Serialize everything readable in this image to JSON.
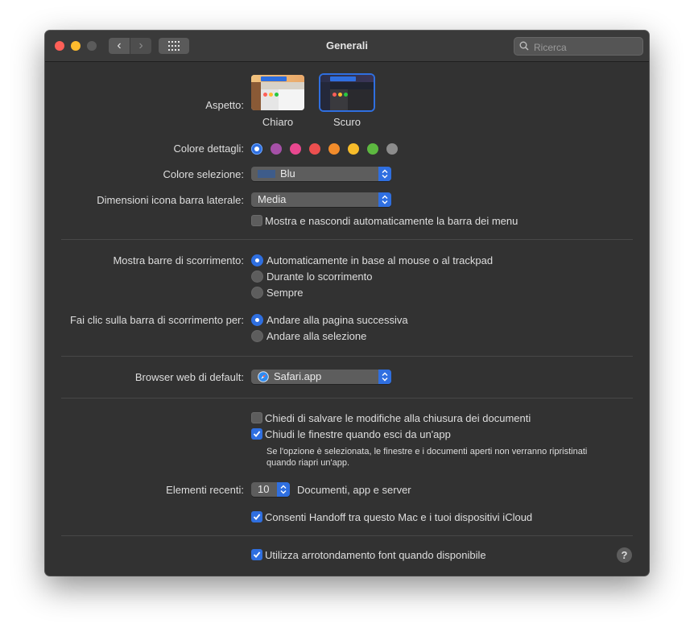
{
  "window": {
    "title": "Generali"
  },
  "search": {
    "placeholder": "Ricerca"
  },
  "appearance": {
    "label": "Aspetto:",
    "options": [
      "Chiaro",
      "Scuro"
    ],
    "selected": "Scuro"
  },
  "accent": {
    "label": "Colore dettagli:",
    "colors": [
      "#2f6fe0",
      "#a550a7",
      "#e8488f",
      "#ec4f4f",
      "#f28c2b",
      "#f7bc2a",
      "#5db840",
      "#8c8c8c"
    ],
    "selected_index": 0
  },
  "highlight": {
    "label": "Colore selezione:",
    "value": "Blu",
    "swatch_color": "#3e5c8a"
  },
  "sidebar_icon": {
    "label": "Dimensioni icona barra laterale:",
    "value": "Media"
  },
  "auto_hide_menu": {
    "label": "Mostra e nascondi automaticamente la barra dei menu",
    "checked": false
  },
  "scroll_bars": {
    "label": "Mostra barre di scorrimento:",
    "options": [
      "Automaticamente in base al mouse o al trackpad",
      "Durante lo scorrimento",
      "Sempre"
    ],
    "selected_index": 0
  },
  "click_scroll": {
    "label": "Fai clic sulla barra di scorrimento per:",
    "options": [
      "Andare alla pagina successiva",
      "Andare alla selezione"
    ],
    "selected_index": 0
  },
  "browser": {
    "label": "Browser web di default:",
    "value": "Safari.app"
  },
  "ask_save": {
    "label": "Chiedi di salvare le modifiche alla chiusura dei documenti",
    "checked": false
  },
  "close_windows": {
    "label": "Chiudi le finestre quando esci da un'app",
    "checked": true,
    "note_line1": "Se l'opzione è selezionata, le finestre e i documenti aperti non verranno ripristinati",
    "note_line2": "quando riapri un'app."
  },
  "recent": {
    "label": "Elementi recenti:",
    "value": "10",
    "suffix": "Documenti, app e server"
  },
  "handoff": {
    "label": "Consenti Handoff tra questo Mac e i tuoi dispositivi iCloud",
    "checked": true
  },
  "font_smoothing": {
    "label": "Utilizza arrotondamento font quando disponibile",
    "checked": true
  },
  "help": {
    "label": "?"
  }
}
